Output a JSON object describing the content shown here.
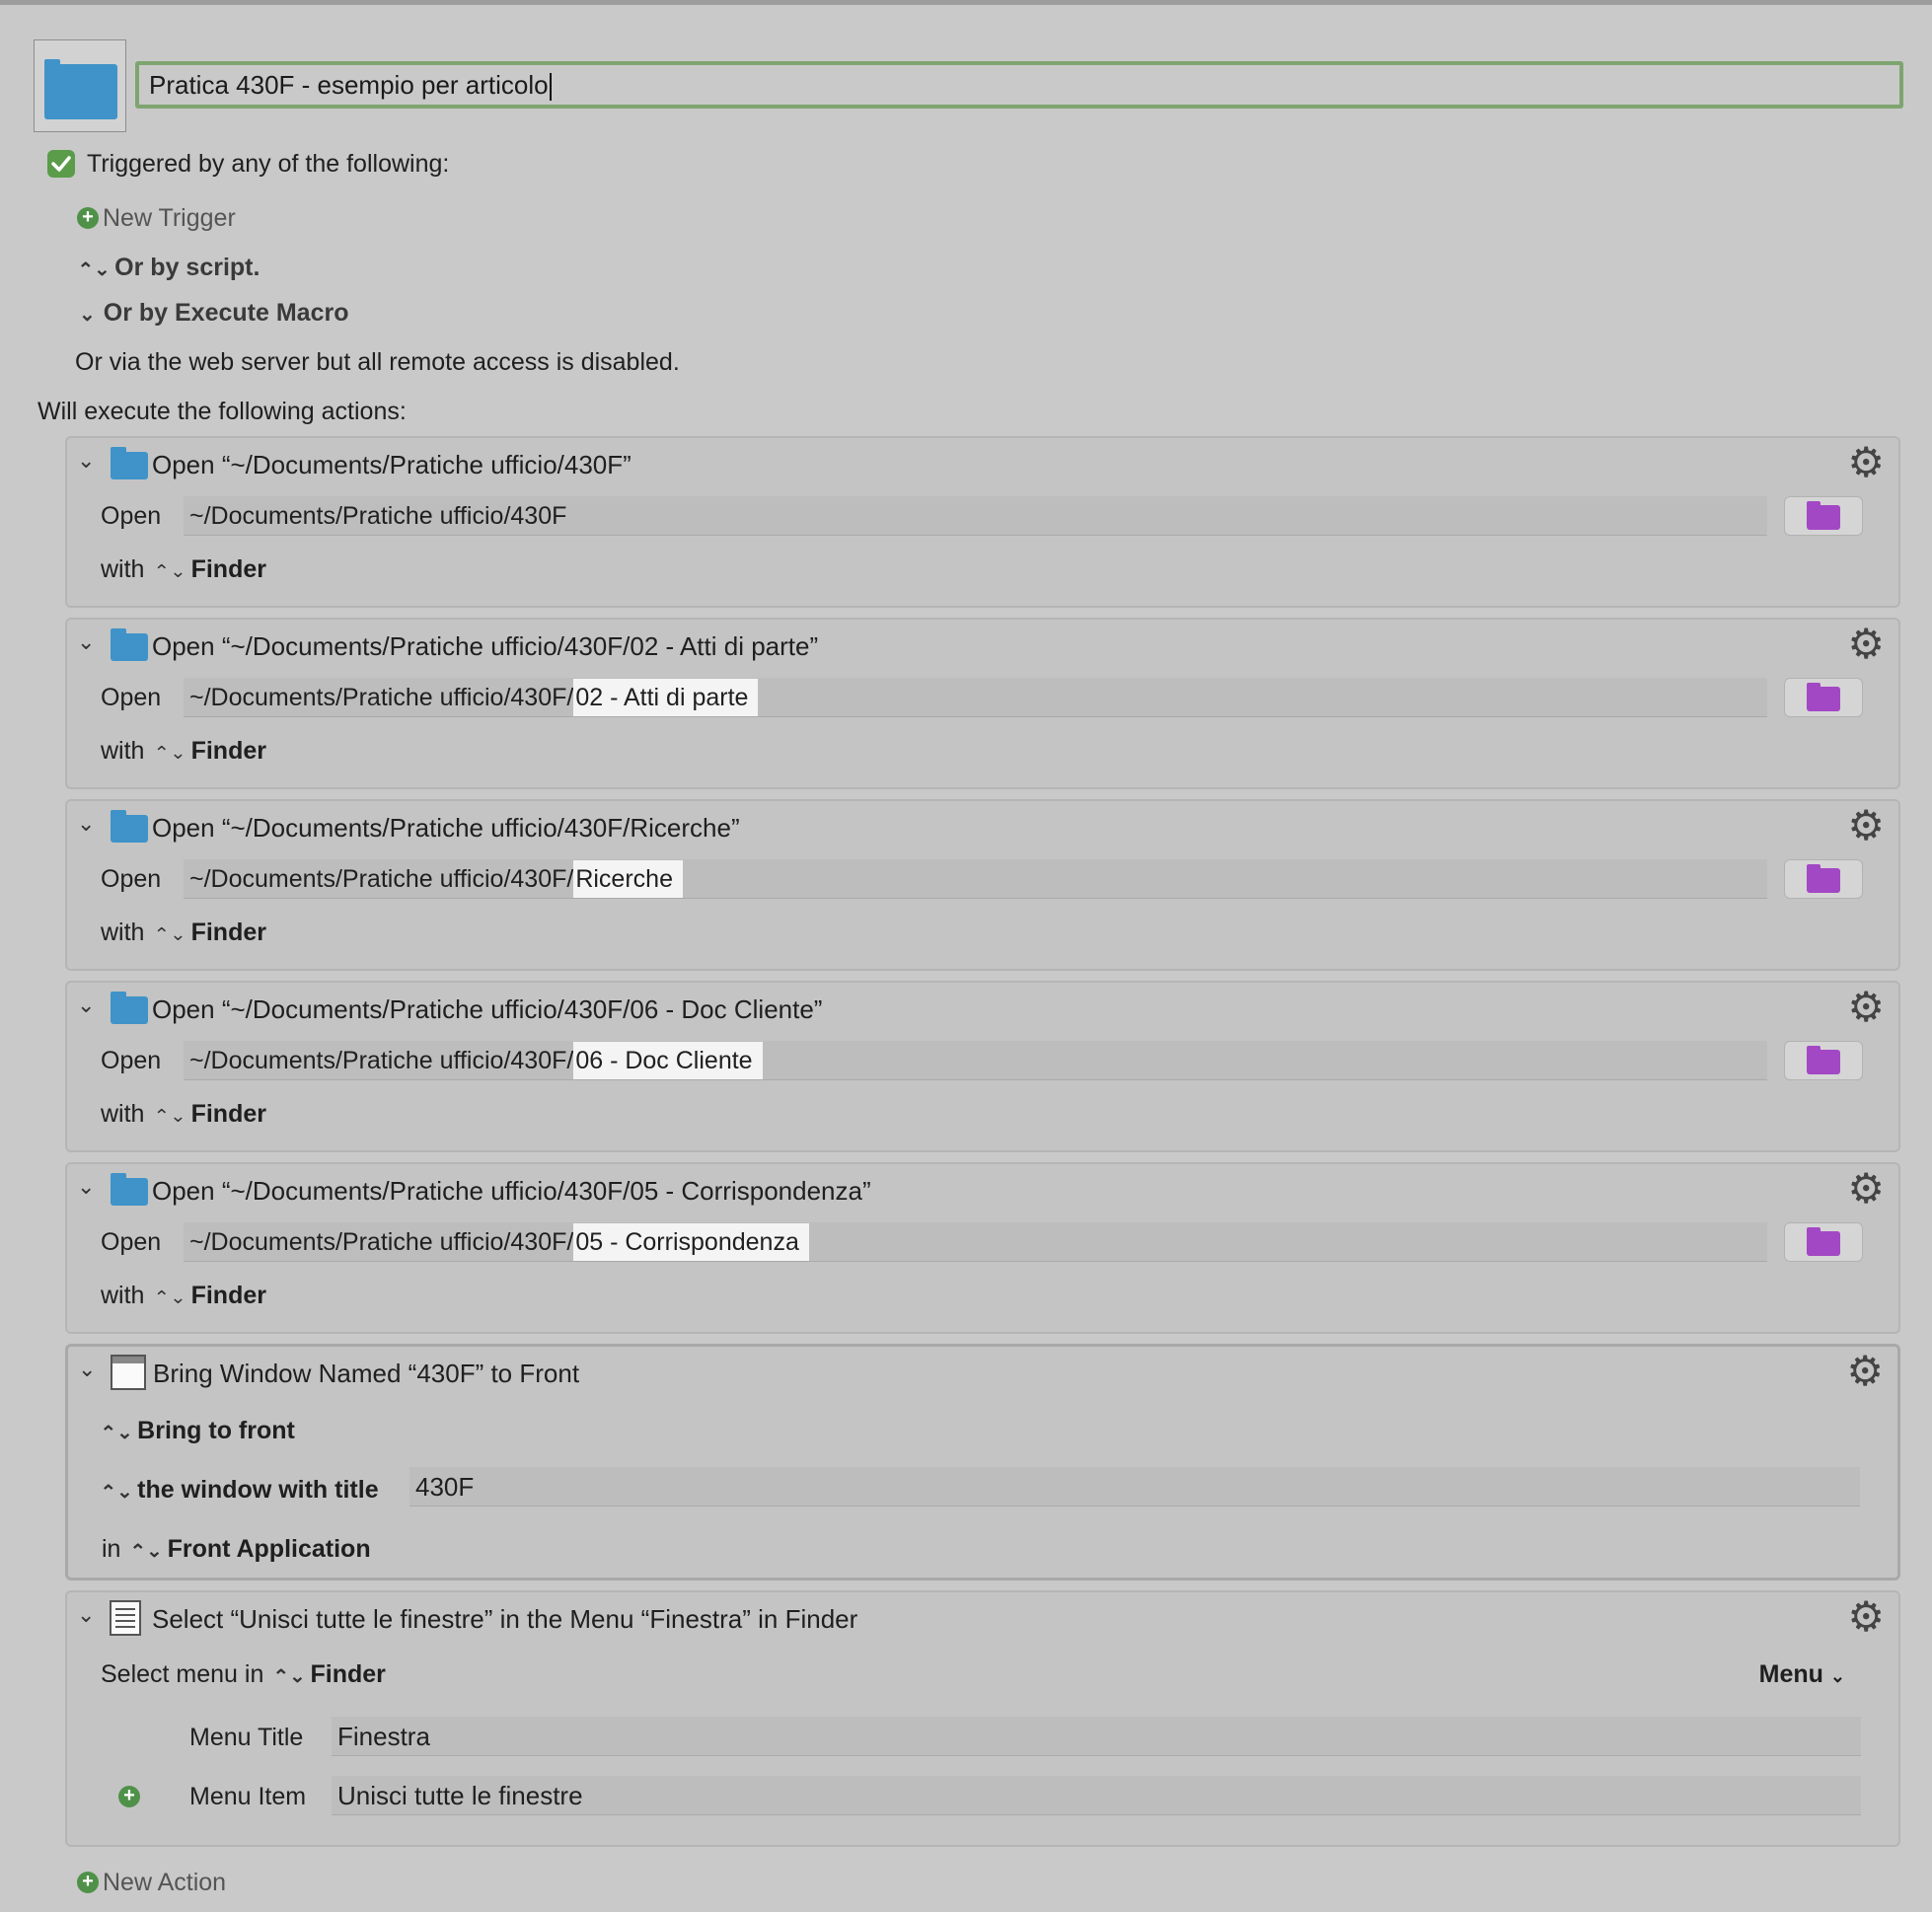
{
  "macro": {
    "name": "Pratica 430F - esempio per articolo",
    "icon": "folder-icon",
    "enabled": true
  },
  "triggers": {
    "heading": "Triggered by any of the following:",
    "new_trigger": "New Trigger",
    "by_script": "Or by script.",
    "by_execute_macro": "Or by Execute Macro",
    "web_server": "Or via the web server but all remote access is disabled."
  },
  "actions_heading": "Will execute the following actions:",
  "open_actions": [
    {
      "title": "Open “~/Documents/Pratiche ufficio/430F”",
      "open_label": "Open",
      "path_prefix": "~/Documents/Pratiche ufficio/430F",
      "path_highlight": "",
      "with_label": "with",
      "app": "Finder"
    },
    {
      "title": "Open “~/Documents/Pratiche ufficio/430F/02 - Atti di parte”",
      "open_label": "Open",
      "path_prefix": "~/Documents/Pratiche ufficio/430F/",
      "path_highlight": "02 - Atti di parte",
      "with_label": "with",
      "app": "Finder"
    },
    {
      "title": "Open “~/Documents/Pratiche ufficio/430F/Ricerche”",
      "open_label": "Open",
      "path_prefix": "~/Documents/Pratiche ufficio/430F/",
      "path_highlight": "Ricerche",
      "with_label": "with",
      "app": "Finder"
    },
    {
      "title": "Open “~/Documents/Pratiche ufficio/430F/06 - Doc Cliente”",
      "open_label": "Open",
      "path_prefix": "~/Documents/Pratiche ufficio/430F/",
      "path_highlight": "06 - Doc Cliente",
      "with_label": "with",
      "app": "Finder"
    },
    {
      "title": "Open “~/Documents/Pratiche ufficio/430F/05 - Corrispondenza”",
      "open_label": "Open",
      "path_prefix": "~/Documents/Pratiche ufficio/430F/",
      "path_highlight": "05 - Corrispondenza",
      "with_label": "with",
      "app": "Finder"
    }
  ],
  "bring_window": {
    "title": "Bring Window Named “430F” to Front",
    "mode": "Bring to front",
    "match": "the window with title",
    "window_title": "430F",
    "in_label": "in",
    "app": "Front Application"
  },
  "select_menu": {
    "title": "Select “Unisci tutte le finestre” in the Menu “Finestra” in Finder",
    "select_label": "Select menu in",
    "app": "Finder",
    "menu_popup": "Menu",
    "menu_title_label": "Menu Title",
    "menu_title": "Finestra",
    "menu_item_label": "Menu Item",
    "menu_item": "Unisci tutte le finestre"
  },
  "new_action": "New Action",
  "colors": {
    "background": "#c9c9c9",
    "accent_green": "#5a9c4a",
    "focus_ring": "#7ea56f",
    "folder_blue": "#3f93c9",
    "folder_purple": "#a348c4"
  }
}
